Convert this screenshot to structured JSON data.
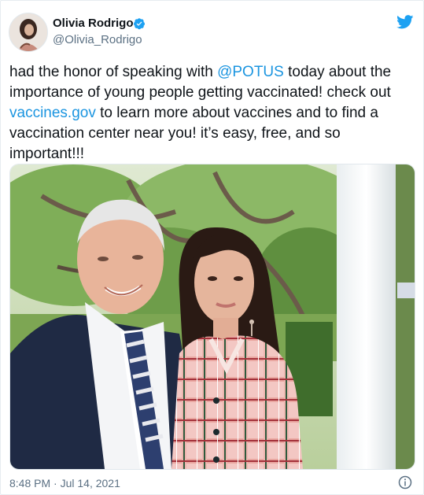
{
  "author": {
    "display_name": "Olivia Rodrigo",
    "handle": "@Olivia_Rodrigo",
    "verified": true
  },
  "tweet": {
    "text_1": "had the honor of speaking with ",
    "mention": "@POTUS",
    "text_2": " today about the importance of young people getting vaccinated! check out ",
    "link": "vaccines.gov",
    "text_3": " to learn more about vaccines and to find a vaccination center near you! it’s easy, free, and so important!!!"
  },
  "timestamp": "8:48 PM · Jul 14, 2021",
  "icons": {
    "avatar": "profile-avatar",
    "verified": "verified-badge-icon",
    "platform": "twitter-bird-icon",
    "info": "info-icon"
  },
  "colors": {
    "link": "#1b95e0",
    "verified": "#1da1f2",
    "muted": "#5b7083",
    "text": "#0f1419"
  }
}
